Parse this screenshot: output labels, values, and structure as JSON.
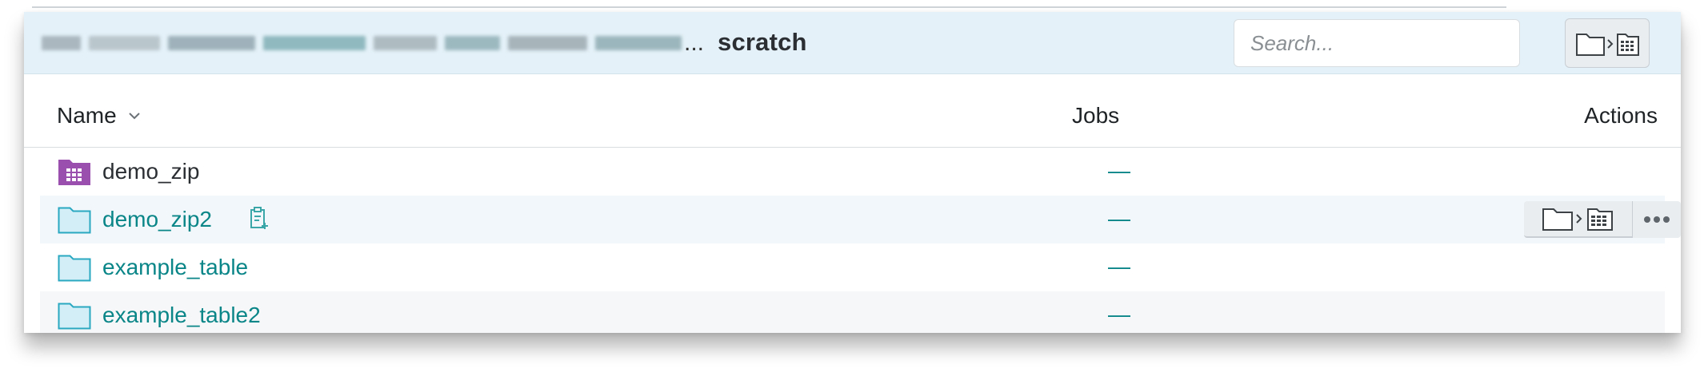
{
  "header": {
    "breadcrumb_ellipsis": "...",
    "current_folder": "scratch",
    "search_placeholder": "Search..."
  },
  "table": {
    "columns": {
      "name": "Name",
      "jobs": "Jobs",
      "actions": "Actions"
    },
    "rows": [
      {
        "name": "demo_zip",
        "jobs": "—",
        "icon": "purple-table-folder-icon",
        "linked": false
      },
      {
        "name": "demo_zip2",
        "jobs": "—",
        "icon": "folder-icon",
        "linked": true
      },
      {
        "name": "example_table",
        "jobs": "—",
        "icon": "folder-icon",
        "linked": true
      },
      {
        "name": "example_table2",
        "jobs": "—",
        "icon": "folder-icon",
        "linked": true
      }
    ]
  },
  "colors": {
    "header_bg": "#e4f1f8",
    "link": "#0a8588",
    "folder_fill": "#d3eef6",
    "folder_stroke": "#2aa8c2",
    "table_folder": "#9a4fae"
  }
}
